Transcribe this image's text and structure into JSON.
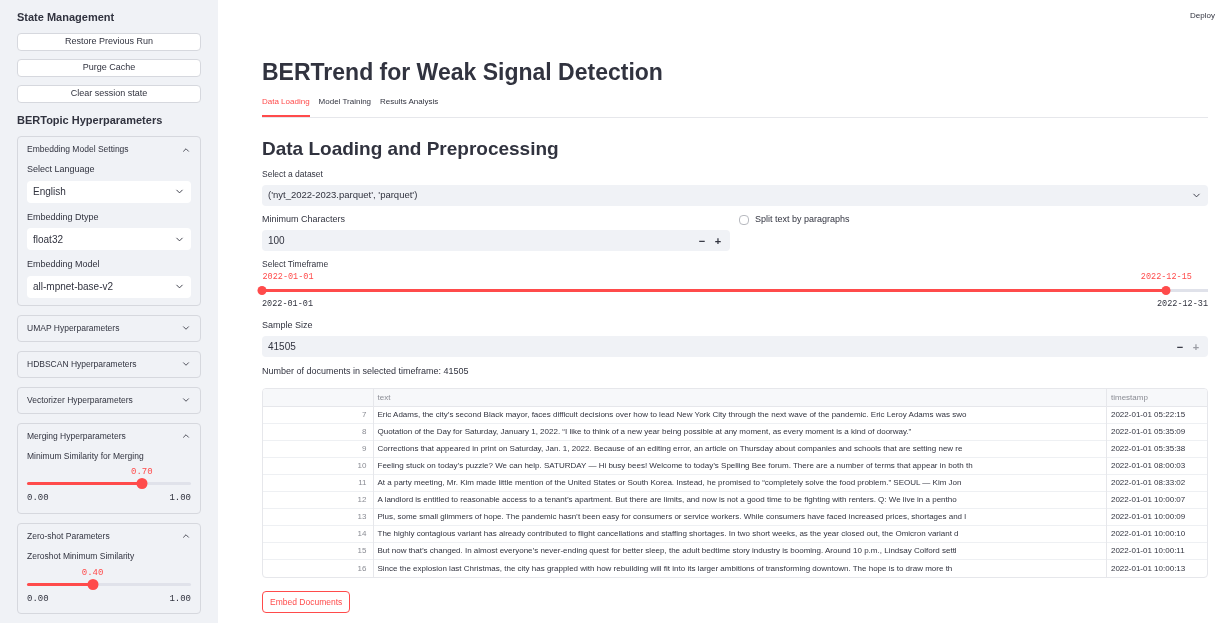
{
  "sidebar": {
    "state_title": "State Management",
    "buttons": [
      "Restore Previous Run",
      "Purge Cache",
      "Clear session state"
    ],
    "params_title": "BERTopic Hyperparameters",
    "expanders": [
      {
        "title": "Embedding Model Settings",
        "expanded": true,
        "fields": [
          {
            "kind": "select",
            "label": "Select Language",
            "value": "English"
          },
          {
            "kind": "select",
            "label": "Embedding Dtype",
            "value": "float32"
          },
          {
            "kind": "select",
            "label": "Embedding Model",
            "value": "all-mpnet-base-v2"
          }
        ]
      },
      {
        "title": "UMAP Hyperparameters",
        "expanded": false
      },
      {
        "title": "HDBSCAN Hyperparameters",
        "expanded": false
      },
      {
        "title": "Vectorizer Hyperparameters",
        "expanded": false
      },
      {
        "title": "Merging Hyperparameters",
        "expanded": true,
        "fields": [
          {
            "kind": "slider",
            "label": "Minimum Similarity for Merging",
            "value": "0.70",
            "level": 0.7,
            "min": "0.00",
            "max": "1.00"
          }
        ]
      },
      {
        "title": "Zero-shot Parameters",
        "expanded": true,
        "fields": [
          {
            "kind": "slider",
            "label": "Zeroshot Minimum Similarity",
            "value": "0.40",
            "level": 0.4,
            "min": "0.00",
            "max": "1.00"
          }
        ]
      }
    ]
  },
  "deploy": "Deploy",
  "title": "BERTrend for Weak Signal Detection",
  "tabs": [
    {
      "label": "Data Loading",
      "selected": true
    },
    {
      "label": "Model Training",
      "selected": false
    },
    {
      "label": "Results Analysis",
      "selected": false
    }
  ],
  "section_title": "Data Loading and Preprocessing",
  "dataset": {
    "label": "Select a dataset",
    "value": "('nyt_2022-2023.parquet', 'parquet')"
  },
  "min_chars": {
    "label": "Minimum Characters",
    "value": "100",
    "minus": "−",
    "plus": "+",
    "plus_disabled": false
  },
  "split_checkbox": {
    "label": "Split text by paragraphs",
    "checked": false
  },
  "timeframe": {
    "label": "Select Timeframe",
    "thumbs": [
      {
        "value": "2022-01-01",
        "level": 0
      },
      {
        "value": "2022-12-15",
        "level": 0.956
      }
    ],
    "min": "2022-01-01",
    "max": "2022-12-31"
  },
  "sample_size": {
    "label": "Sample Size",
    "value": "41505",
    "minus": "−",
    "plus": "+",
    "plus_disabled": true
  },
  "doc_count": "Number of documents in selected timeframe: 41505",
  "table": {
    "columns": [
      "text",
      "timestamp"
    ],
    "rows": [
      {
        "index": "7",
        "text": "Eric Adams, the city’s second Black mayor, faces difficult decisions over how to lead New York City through the next wave of the pandemic. Eric Leroy Adams was swo",
        "timestamp": "2022-01-01 05:22:15"
      },
      {
        "index": "8",
        "text": "Quotation of the Day for Saturday, January 1, 2022. “I like to think of a new year being possible at any moment, as every moment is a kind of doorway.”",
        "timestamp": "2022-01-01 05:35:09"
      },
      {
        "index": "9",
        "text": "Corrections that appeared in print on Saturday, Jan. 1, 2022. Because of an editing error, an article on Thursday about companies and schools that are setting new re",
        "timestamp": "2022-01-01 05:35:38"
      },
      {
        "index": "10",
        "text": "Feeling stuck on today’s puzzle? We can help. SATURDAY — Hi busy bees! Welcome to today’s Spelling Bee forum. There are a number of terms that appear in both th",
        "timestamp": "2022-01-01 08:00:03"
      },
      {
        "index": "11",
        "text": "At a party meeting, Mr. Kim made little mention of the United States or South Korea. Instead, he promised to “completely solve the food problem.” SEOUL — Kim Jon",
        "timestamp": "2022-01-01 08:33:02"
      },
      {
        "index": "12",
        "text": "A landlord is entitled to reasonable access to a tenant’s apartment. But there are limits, and now is not a good time to be fighting with renters. Q: We live in a pentho",
        "timestamp": "2022-01-01 10:00:07"
      },
      {
        "index": "13",
        "text": "Plus, some small glimmers of hope. The pandemic hasn’t been easy for consumers or service workers. While consumers have faced increased prices, shortages and l",
        "timestamp": "2022-01-01 10:00:09"
      },
      {
        "index": "14",
        "text": "The highly contagious variant has already contributed to flight cancellations and staffing shortages. In two short weeks, as the year closed out, the Omicron variant d",
        "timestamp": "2022-01-01 10:00:10"
      },
      {
        "index": "15",
        "text": "But now that’s changed. In almost everyone’s never-ending quest for better sleep, the adult bedtime story industry is booming. Around 10 p.m., Lindsay Colford settl",
        "timestamp": "2022-01-01 10:00:11"
      },
      {
        "index": "16",
        "text": "Since the explosion last Christmas, the city has grappled with how rebuilding will fit into its larger ambitions of transforming downtown. The hope is to draw more th",
        "timestamp": "2022-01-01 10:00:13"
      }
    ]
  },
  "embed_button": "Embed Documents"
}
